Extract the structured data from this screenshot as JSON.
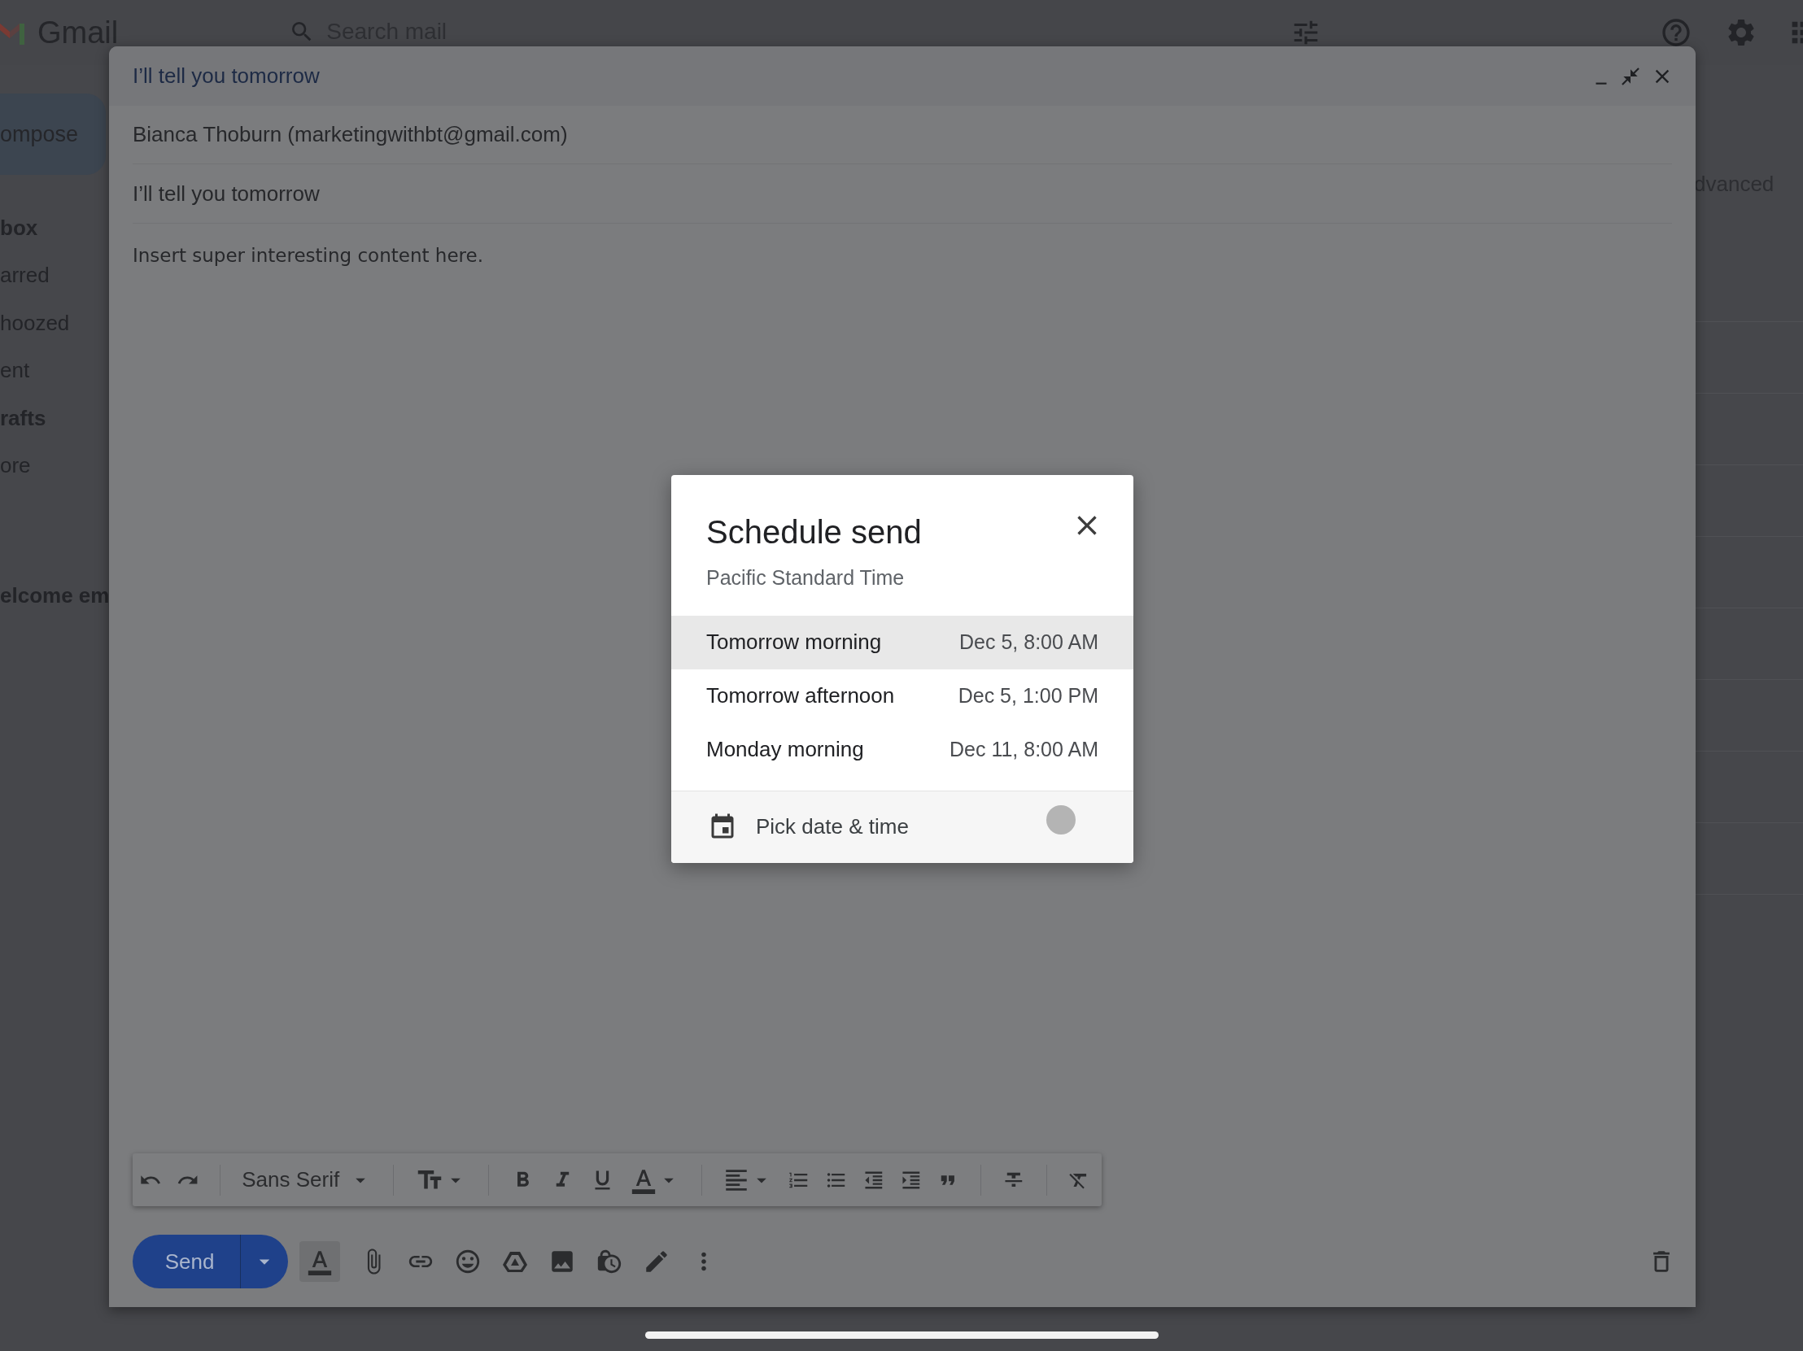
{
  "app_bar": {
    "logo_text": "Gmail",
    "search": {
      "placeholder": "Search mail"
    }
  },
  "sidebar": {
    "compose_label": "ompose",
    "items": [
      {
        "label": "box",
        "bold": true
      },
      {
        "label": "arred",
        "bold": false
      },
      {
        "label": "hoozed",
        "bold": false
      },
      {
        "label": "ent",
        "bold": false
      },
      {
        "label": "rafts",
        "bold": true
      },
      {
        "label": "ore",
        "bold": false
      }
    ],
    "label_item": {
      "label": "elcome em",
      "bold": true
    }
  },
  "mail_list": {
    "partial_link": "dvanced"
  },
  "compose": {
    "title": "I’ll tell you tomorrow",
    "to": "Bianca Thoburn (marketingwithbt@gmail.com)",
    "subject": "I’ll tell you tomorrow",
    "body": "Insert super interesting content here.",
    "font": "Sans Serif",
    "send_label": "Send"
  },
  "schedule_dialog": {
    "title": "Schedule send",
    "timezone": "Pacific Standard Time",
    "options": [
      {
        "label": "Tomorrow morning",
        "time": "Dec 5, 8:00 AM",
        "selected": true
      },
      {
        "label": "Tomorrow afternoon",
        "time": "Dec 5, 1:00 PM",
        "selected": false
      },
      {
        "label": "Monday morning",
        "time": "Dec 11, 8:00 AM",
        "selected": false
      }
    ],
    "custom_label": "Pick date & time"
  }
}
